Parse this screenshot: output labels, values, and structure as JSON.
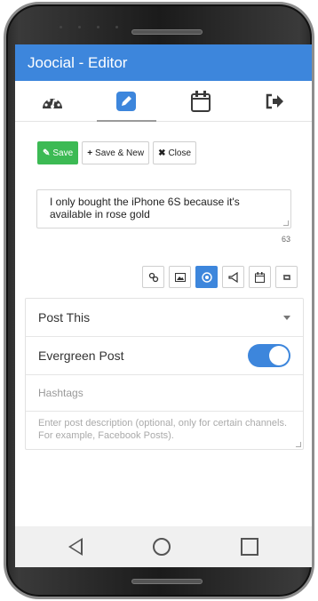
{
  "app": {
    "title": "Joocial - Editor"
  },
  "tabs": [
    {
      "icon": "dashboard-icon"
    },
    {
      "icon": "edit-icon",
      "active": true
    },
    {
      "icon": "calendar-icon"
    },
    {
      "icon": "sign-out-icon"
    }
  ],
  "toolbar": {
    "save_label": "Save",
    "save_new_label": "Save & New",
    "close_label": "Close"
  },
  "post": {
    "text": "I only bought the iPhone 6S because it's available in rose gold",
    "char_count": "63"
  },
  "tools": [
    {
      "icon": "link-icon"
    },
    {
      "icon": "image-icon"
    },
    {
      "icon": "target-icon",
      "active": true
    },
    {
      "icon": "megaphone-icon"
    },
    {
      "icon": "calendar-icon"
    },
    {
      "icon": "retweet-icon"
    }
  ],
  "form": {
    "post_this_label": "Post This",
    "evergreen_label": "Evergreen Post",
    "evergreen_on": true,
    "hashtags_placeholder": "Hashtags",
    "description_placeholder": "Enter post description (optional, only for certain channels. For example, Facebook Posts)."
  },
  "colors": {
    "primary": "#3d86dc",
    "success": "#3cba54"
  }
}
